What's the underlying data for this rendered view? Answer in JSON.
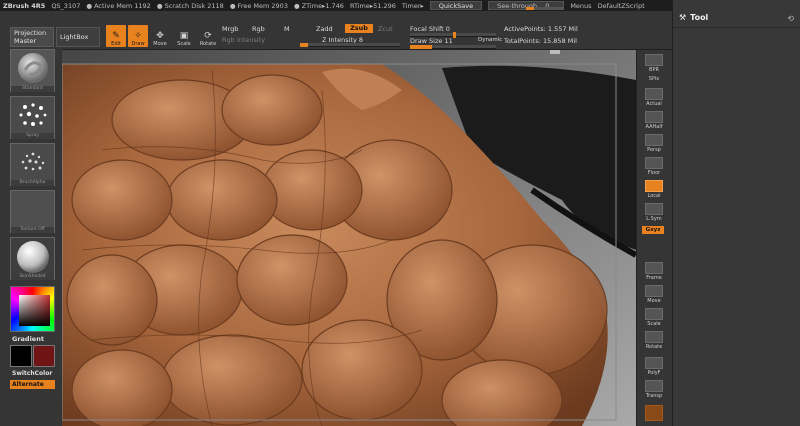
{
  "titlebar": {
    "app": "ZBrush 4R5",
    "items": [
      "QS_3107",
      "● Active Mem 1192",
      "● Scratch Disk 2118",
      "● Free Mem 2903",
      "● ZTime▸1.746",
      "RTime▸51.296",
      "Timer▸"
    ],
    "quicksave": "QuickSave",
    "seethrough": "See-through",
    "seethrough_value": "0",
    "seethrough_level": 0.2,
    "menus": "Menus",
    "script": "DefaultZScript"
  },
  "shelf": {
    "edit": "Edit",
    "draw": "Draw",
    "move": "Move",
    "scale": "Scale",
    "rotate": "Rotate",
    "mrgb": "Mrgb",
    "rgb": "Rgb",
    "m": "M",
    "rgb_intensity": "Rgb Intensity",
    "zadd": "Zadd",
    "zsub": "Zsub",
    "zcut": "Zcut",
    "z_intensity": "Z Intensity 8",
    "z_intensity_level": 0.08,
    "focal_shift": "Focal Shift 0",
    "focal_shift_level": 0.5,
    "draw_size": "Draw Size 11",
    "draw_size_level": 0.25,
    "dynamic": "Dynamic",
    "active_points": "ActivePoints: 1.557 Mil",
    "total_points": "TotalPoints: 15.858 Mil"
  },
  "lefttray": {
    "projection_master": "Projection Master",
    "lightbox": "LightBox",
    "brushes": [
      "Standard",
      "Spray",
      "BrushAlpha",
      "Texture Off",
      "SkinShade4"
    ],
    "gradient": "Gradient",
    "switchcolor": "SwitchColor",
    "alternate": "Alternate"
  },
  "righttray": {
    "buttons": [
      "BPR",
      "SPix",
      "Actual",
      "AAHalf",
      "Persp",
      "Floor",
      "Local",
      "L.Sym",
      "Frame",
      "Move",
      "Scale",
      "Rotate",
      "PolyF",
      "Transp"
    ],
    "xyz": "Gxyz"
  },
  "toolpal": {
    "title": "Tool"
  },
  "colors": {
    "accent": "#e8821e",
    "skin": "#b9754a",
    "primary_color": "#000000",
    "secondary_color": "#6e1414"
  }
}
